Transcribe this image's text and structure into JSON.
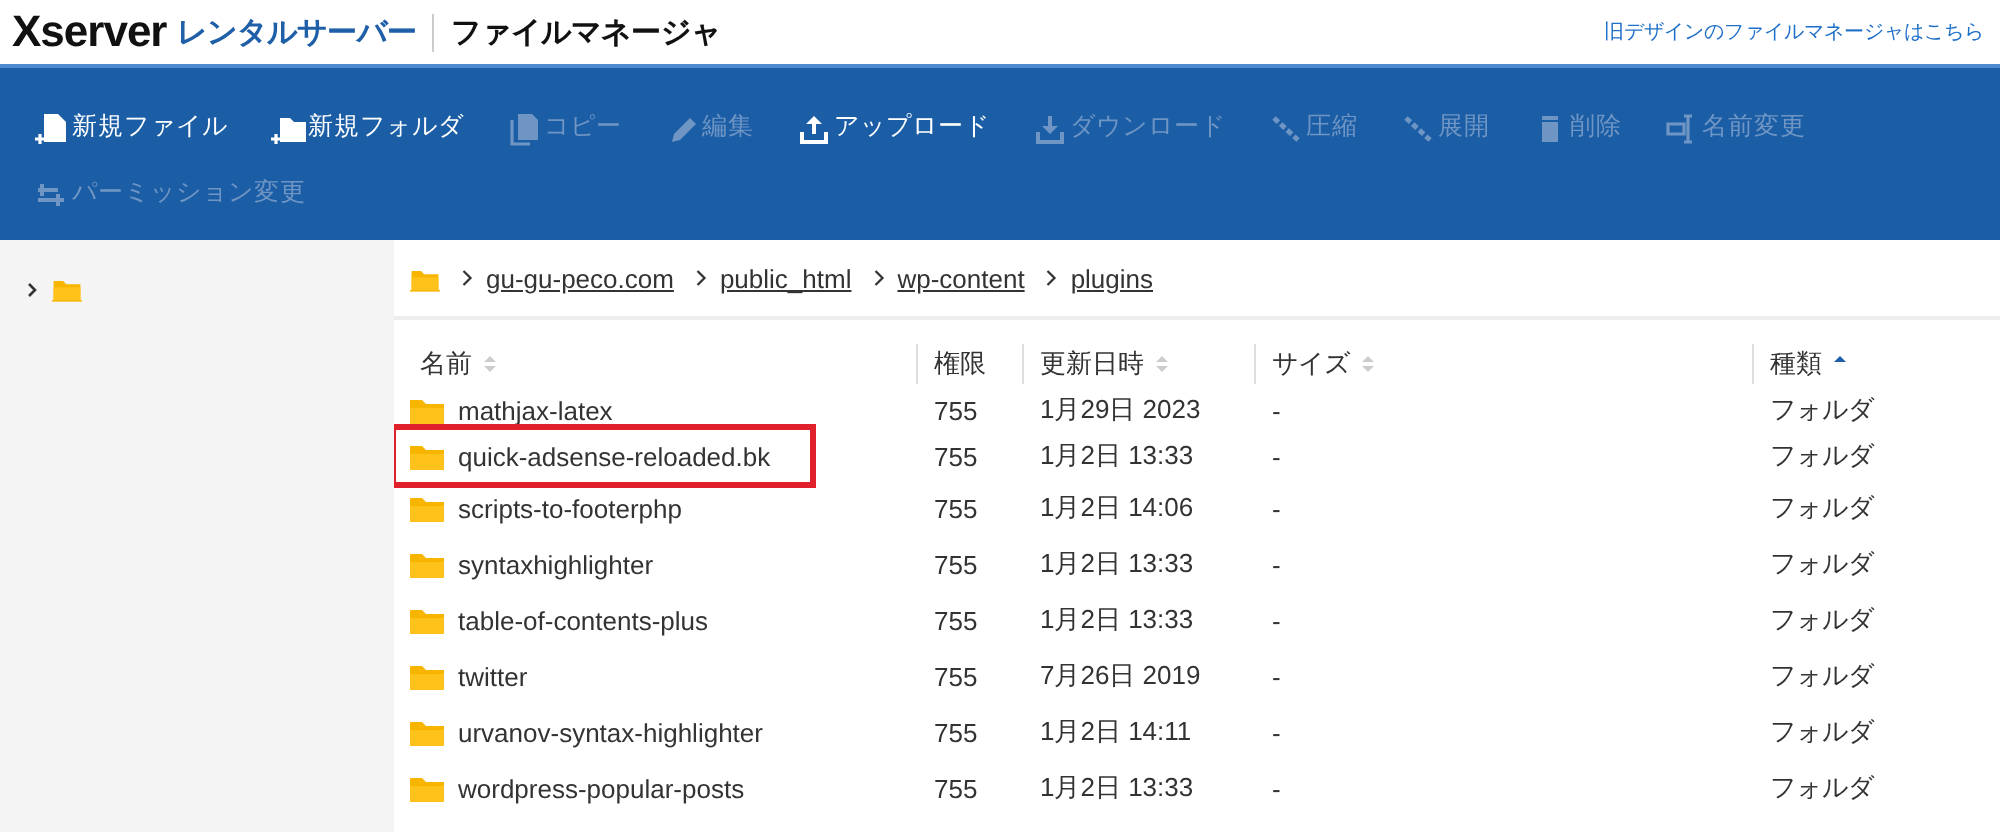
{
  "header": {
    "logo": "Xserver",
    "service": "レンタルサーバー",
    "title": "ファイルマネージャ",
    "link": "旧デザインのファイルマネージャはこちら"
  },
  "toolbar": [
    {
      "label": "新規ファイル",
      "disabled": false
    },
    {
      "label": "新規フォルダ",
      "disabled": false
    },
    {
      "label": "コピー",
      "disabled": true
    },
    {
      "label": "編集",
      "disabled": true
    },
    {
      "label": "アップロード",
      "disabled": false
    },
    {
      "label": "ダウンロード",
      "disabled": true
    },
    {
      "label": "圧縮",
      "disabled": true
    },
    {
      "label": "展開",
      "disabled": true
    },
    {
      "label": "削除",
      "disabled": true
    },
    {
      "label": "名前変更",
      "disabled": true
    },
    {
      "label": "パーミッション変更",
      "disabled": true
    }
  ],
  "tree": {
    "expanded": false
  },
  "breadcrumb": [
    "gu-gu-peco.com",
    "public_html",
    "wp-content",
    "plugins"
  ],
  "table": {
    "columns": [
      {
        "label": "名前",
        "sorted": false
      },
      {
        "label": "権限"
      },
      {
        "label": "更新日時",
        "sorted": false
      },
      {
        "label": "サイズ",
        "sorted": false
      },
      {
        "label": "種類",
        "sorted": true
      }
    ],
    "rows": [
      {
        "name": "mathjax-latex",
        "perm": "755",
        "modified": "1月29日 2023",
        "size": "-",
        "type": "フォルダ",
        "highlighted": false
      },
      {
        "name": "quick-adsense-reloaded.bk",
        "perm": "755",
        "modified": "1月2日 13:33",
        "size": "-",
        "type": "フォルダ",
        "highlighted": true
      },
      {
        "name": "scripts-to-footerphp",
        "perm": "755",
        "modified": "1月2日 14:06",
        "size": "-",
        "type": "フォルダ",
        "highlighted": false
      },
      {
        "name": "syntaxhighlighter",
        "perm": "755",
        "modified": "1月2日 13:33",
        "size": "-",
        "type": "フォルダ",
        "highlighted": false
      },
      {
        "name": "table-of-contents-plus",
        "perm": "755",
        "modified": "1月2日 13:33",
        "size": "-",
        "type": "フォルダ",
        "highlighted": false
      },
      {
        "name": "twitter",
        "perm": "755",
        "modified": "7月26日 2019",
        "size": "-",
        "type": "フォルダ",
        "highlighted": false
      },
      {
        "name": "urvanov-syntax-highlighter",
        "perm": "755",
        "modified": "1月2日 14:11",
        "size": "-",
        "type": "フォルダ",
        "highlighted": false
      },
      {
        "name": "wordpress-popular-posts",
        "perm": "755",
        "modified": "1月2日 13:33",
        "size": "-",
        "type": "フォルダ",
        "highlighted": false
      }
    ]
  }
}
